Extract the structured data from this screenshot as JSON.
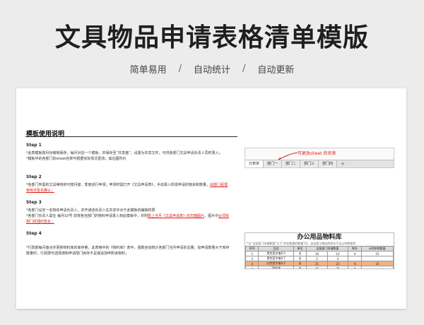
{
  "header": {
    "title": "文具物品申请表格清单模版",
    "features": [
      "简单易用",
      "自动统计",
      "自动更新"
    ],
    "separator": "/"
  },
  "doc": {
    "section_title": "模板使用说明",
    "steps": [
      {
        "label": "Step 1",
        "lines": [
          [
            {
              "t": "*此表模板按月份做制保存，每月对应一个模板，并保存至“共享盘”，设置为共享文件，可供各部门文具申请负责人同时录入；"
            }
          ],
          [
            {
              "t": "*模板中的各部门的sheet名称可根据实际情况更改；如右图所示"
            }
          ]
        ]
      },
      {
        "label": "Step 2",
        "lines": [
          [
            {
              "t": "*各部门所需的文具等物资可按月度，季度进行申领；申领时需打开《文具申请表》，手动录入所需申请的物资和数量，"
            },
            {
              "t": "由部门经理审核并签名确认；",
              "red": true
            }
          ]
        ]
      },
      {
        "label": "Step 3",
        "lines": [
          [
            {
              "t": "*各部门设定一名物资申请负责人，并开通该负责人在共享中对于此模板的编辑权限"
            }
          ],
          [
            {
              "t": "*各部门负责人需在 每月10号 前将各自部门的物料申请录入到此模板中，并附"
            },
            {
              "t": "剧上当月《文具申请表》的扫描图片",
              "red": true
            },
            {
              "t": "，图片中"
            },
            {
              "t": "必须有部门经理的签名；",
              "red": true
            }
          ]
        ]
      },
      {
        "label": "Step 4",
        "lines": [
          [
            {
              "t": "*行政部每月盘点并更新物料库的库存量，此表格中的《物料库》表中，函数自动统计各部门当月申请的总量，如申请数量大于库存数量时，行政部可选择通知申请部门库存不足或追加申购该物料；"
            }
          ]
        ]
      }
    ]
  },
  "screenshot_tabs": {
    "annotation": "可更改sheet 的名称",
    "tabs": [
      "分表单",
      "部门一",
      "部门二",
      "部门三",
      "部门四"
    ],
    "active_index": 0,
    "plus": "+"
  },
  "screenshot_table": {
    "title": "办公用品物料库",
    "note": "*当“全部部门申请数量”大于“库存数量的数量”时，自动提示物料库库存不足以申购物资",
    "headers": [
      "序号",
      "品名",
      "单位",
      "全部部门申请数量",
      "库存",
      "计划申购数量"
    ],
    "rows": [
      [
        "1",
        "黑色签字笔0.5",
        "支",
        "10",
        "14",
        "4",
        "15"
      ],
      [
        "2",
        "黑色签字笔0.7",
        "支",
        "2",
        "3",
        "",
        ""
      ],
      [
        "3",
        "红色签字笔0.5",
        "支",
        "21",
        "21",
        "-6",
        "10"
      ],
      [
        "4",
        "2B铅笔",
        "支",
        "25",
        "25",
        "0",
        ""
      ]
    ],
    "highlight_row": 2
  }
}
